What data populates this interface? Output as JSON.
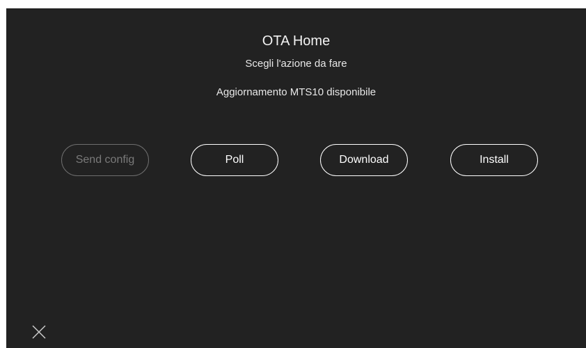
{
  "header": {
    "title": "OTA Home",
    "subtitle": "Scegli l'azione da fare",
    "status": "Aggiornamento MTS10 disponibile"
  },
  "actions": {
    "send_config": {
      "label": "Send config",
      "enabled": false
    },
    "poll": {
      "label": "Poll",
      "enabled": true
    },
    "download": {
      "label": "Download",
      "enabled": true
    },
    "install": {
      "label": "Install",
      "enabled": true
    }
  },
  "footer": {
    "close_icon": "close-icon"
  },
  "colors": {
    "background": "#222222",
    "text": "#ffffff",
    "disabled": "#6e6e6e"
  }
}
